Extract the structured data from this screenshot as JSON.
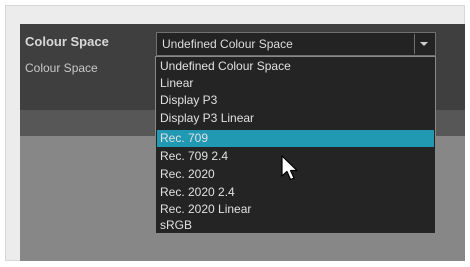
{
  "section": {
    "title": "Colour Space"
  },
  "field": {
    "label": "Colour Space",
    "selected_value": "Undefined Colour Space",
    "dropdown_icon": "chevron-down-icon"
  },
  "dropdown": {
    "options": [
      "Undefined Colour Space",
      "Linear",
      "Display P3",
      "Display P3 Linear",
      "Rec. 709",
      "Rec. 709 2.4",
      "Rec. 2020",
      "Rec. 2020 2.4",
      "Rec. 2020 Linear",
      "sRGB"
    ],
    "highlighted": "Rec. 709",
    "highlight_color": "#2199b3"
  },
  "colors": {
    "dialog_bg": "#3f3f3f",
    "field_bg": "#232323",
    "list_bg": "#242424",
    "text": "#e0e0e0"
  }
}
